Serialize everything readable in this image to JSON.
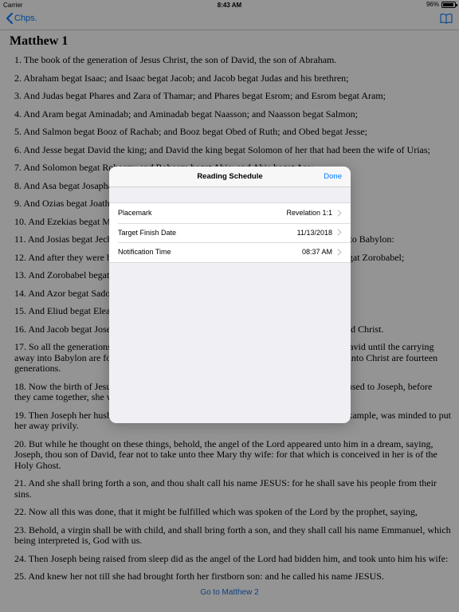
{
  "status_bar": {
    "carrier": "Carrier",
    "time": "8:43 AM",
    "battery": "96%"
  },
  "nav": {
    "back_label": "Chps.",
    "book_icon": "book-icon"
  },
  "chapter_title": "Matthew 1",
  "verses": [
    "1. The book of the generation of Jesus Christ, the son of David, the son of Abraham.",
    "2. Abraham begat Isaac; and Isaac begat Jacob; and Jacob begat Judas and his brethren;",
    "3. And Judas begat Phares and Zara of Thamar; and Phares begat Esrom; and Esrom begat Aram;",
    "4. And Aram begat Aminadab; and Aminadab begat Naasson; and Naasson begat Salmon;",
    "5. And Salmon begat Booz of Rachab; and Booz begat Obed of Ruth; and Obed begat Jesse;",
    "6. And Jesse begat David the king; and David the king begat Solomon of her that had been the wife of Urias;",
    "7. And Solomon begat Roboam; and Roboam begat Abia; and Abia begat Asa;",
    "8. And Asa begat Josaphat; and Josaphat begat Joram; and Joram begat Ozias;",
    "9. And Ozias begat Joatham; and Joatham begat Achaz; and Achaz begat Ezekias;",
    "10. And Ezekias begat Manasses; and Manasses begat Amon; and Amon begat Josias;",
    "11. And Josias begat Jechonias and his brethren, about the time they were carried away to Babylon:",
    "12. And after they were brought to Babylon, Jechonias begat Salathiel; and Salathiel begat Zorobabel;",
    "13. And Zorobabel begat Abiud; and Abiud begat Eliakim; and Eliakim begat Azor;",
    "14. And Azor begat Sadoc; and Sadoc begat Achim; and Achim begat Eliud;",
    "15. And Eliud begat Eleazar; and Eleazar begat Matthan; and Matthan begat Jacob;",
    "16. And Jacob begat Joseph the husband of Mary, of whom was born Jesus, who is called Christ.",
    "17. So all the generations from Abraham to David are fourteen generations; and from David until the carrying away into Babylon are fourteen generations; and from the carrying away into Babylon unto Christ are fourteen generations.",
    "18. Now the birth of Jesus Christ was on this wise: When as his mother Mary was espoused to Joseph, before they came together, she was found with child of the Holy Ghost.",
    "19. Then Joseph her husband, being a just man, and not willing to make her a publick example, was minded to put her away privily.",
    "20. But while he thought on these things, behold, the angel of the Lord appeared unto him in a dream, saying, Joseph, thou son of David, fear not to take unto thee Mary thy wife: for that which is conceived in her is of the Holy Ghost.",
    "21. And she shall bring forth a son, and thou shalt call his name JESUS: for he shall save his people from their sins.",
    "22. Now all this was done, that it might be fulfilled which was spoken of the Lord by the prophet, saying,",
    "23. Behold, a virgin shall be with child, and shall bring forth a son, and they shall call his name Emmanuel, which being interpreted is, God with us.",
    "24. Then Joseph being raised from sleep did as the angel of the Lord had bidden him, and took unto him his wife:",
    "25. And knew her not till she had brought forth her firstborn son: and he called his name JESUS."
  ],
  "goto_link": "Go to Matthew 2",
  "modal": {
    "title": "Reading Schedule",
    "done_label": "Done",
    "rows": [
      {
        "label": "Placemark",
        "value": "Revelation 1:1"
      },
      {
        "label": "Target Finish Date",
        "value": "11/13/2018"
      },
      {
        "label": "Notification Time",
        "value": "08:37 AM"
      }
    ]
  },
  "colors": {
    "accent": "#007aff",
    "overlay": "rgba(0,0,0,0.42)",
    "modal_bg": "#efeff4"
  }
}
